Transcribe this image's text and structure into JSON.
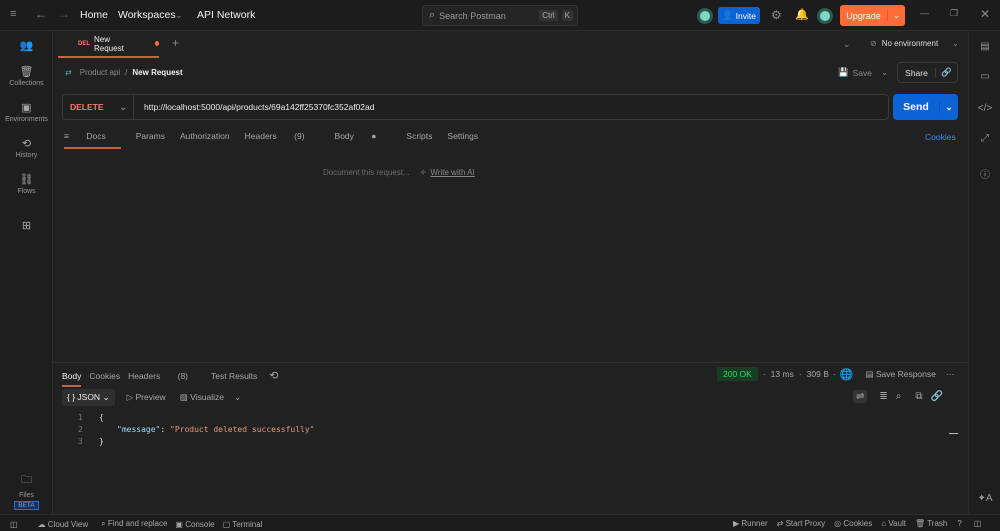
{
  "topbar": {
    "home": "Home",
    "workspaces": "Workspaces",
    "api_network": "API Network",
    "search_placeholder": "Search Postman",
    "shortcut_ctrl": "Ctrl",
    "shortcut_k": "K",
    "invite": "Invite",
    "upgrade": "Upgrade"
  },
  "sidebar": {
    "items": [
      {
        "label": "Collections"
      },
      {
        "label": "Environments"
      },
      {
        "label": "History"
      },
      {
        "label": "Flows"
      }
    ],
    "files": "Files",
    "beta": "BETA"
  },
  "tab": {
    "method": "DEL",
    "title": "New Request"
  },
  "environment": "No environment",
  "breadcrumb": {
    "collection": "Product api",
    "sep": "/",
    "request": "New Request"
  },
  "actions": {
    "save": "Save",
    "share": "Share"
  },
  "request": {
    "method": "DELETE",
    "url": "http://localhost:5000/api/products/69a142ff25370fc352af02ad",
    "send": "Send"
  },
  "request_tabs": {
    "docs": "Docs",
    "params": "Params",
    "authorization": "Authorization",
    "headers": "Headers",
    "headers_count": "(9)",
    "body": "Body",
    "scripts": "Scripts",
    "settings": "Settings",
    "cookies": "Cookies"
  },
  "docs": {
    "placeholder": "Document this request...",
    "write_ai": "Write with AI"
  },
  "response": {
    "tabs": {
      "body": "Body",
      "cookies": "Cookies",
      "headers": "Headers",
      "headers_count": "(8)",
      "tests": "Test Results"
    },
    "status": "200 OK",
    "time": "13 ms",
    "size": "309 B",
    "save_response": "Save Response",
    "format": "JSON",
    "preview": "Preview",
    "visualize": "Visualize",
    "lines": [
      {
        "n": "1",
        "text": "{"
      },
      {
        "n": "2",
        "key": "\"message\"",
        "colon": ": ",
        "value": "\"Product deleted successfully\""
      },
      {
        "n": "3",
        "text": "}"
      }
    ]
  },
  "statusbar": {
    "cloud": "Cloud View",
    "find": "Find and replace",
    "console": "Console",
    "terminal": "Terminal",
    "runner": "Runner",
    "proxy": "Start Proxy",
    "cookies": "Cookies",
    "vault": "Vault",
    "trash": "Trash"
  },
  "colors": {
    "accent": "#ff6c37",
    "blue": "#0b63d6",
    "delete": "#f57b6c",
    "ok": "#3fb950"
  }
}
